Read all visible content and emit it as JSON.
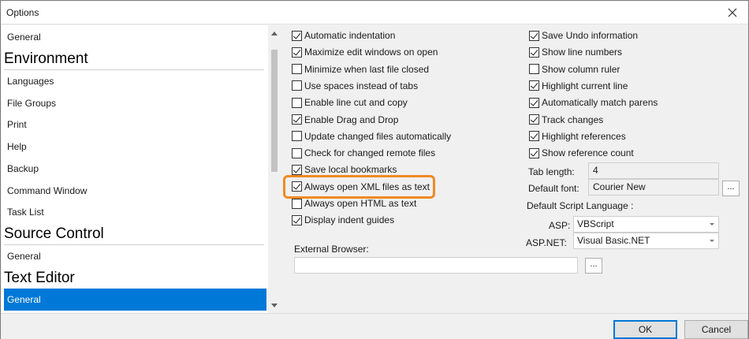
{
  "window": {
    "title": "Options"
  },
  "tree": {
    "items": [
      {
        "kind": "item",
        "label": "General"
      },
      {
        "kind": "category",
        "label": "Environment"
      },
      {
        "kind": "item",
        "label": "Languages"
      },
      {
        "kind": "item",
        "label": "File Groups"
      },
      {
        "kind": "item",
        "label": "Print"
      },
      {
        "kind": "item",
        "label": "Help"
      },
      {
        "kind": "item",
        "label": "Backup"
      },
      {
        "kind": "item",
        "label": "Command Window"
      },
      {
        "kind": "item",
        "label": "Task List"
      },
      {
        "kind": "category",
        "label": "Source Control"
      },
      {
        "kind": "item",
        "label": "General"
      },
      {
        "kind": "category",
        "label": "Text Editor"
      },
      {
        "kind": "item",
        "label": "General",
        "selected": true
      }
    ]
  },
  "options": {
    "left": [
      {
        "label": "Automatic indentation",
        "checked": true
      },
      {
        "label": "Maximize edit windows on open",
        "checked": true
      },
      {
        "label": "Minimize when last file closed",
        "checked": false
      },
      {
        "label": "Use spaces instead of tabs",
        "checked": false
      },
      {
        "label": "Enable line cut and copy",
        "checked": false
      },
      {
        "label": "Enable Drag and Drop",
        "checked": true
      },
      {
        "label": "Update changed files automatically",
        "checked": false
      },
      {
        "label": "Check for changed remote files",
        "checked": false
      },
      {
        "label": "Save local bookmarks",
        "checked": true
      },
      {
        "label": "Always open XML files as text",
        "checked": true
      },
      {
        "label": "Always open HTML as text",
        "checked": false
      },
      {
        "label": "Display indent guides",
        "checked": true
      }
    ],
    "right": [
      {
        "label": "Save Undo information",
        "checked": true
      },
      {
        "label": "Show line numbers",
        "checked": true
      },
      {
        "label": "Show column ruler",
        "checked": false
      },
      {
        "label": "Highlight current line",
        "checked": true
      },
      {
        "label": "Automatically match parens",
        "checked": true
      },
      {
        "label": "Track changes",
        "checked": true
      },
      {
        "label": "Highlight references",
        "checked": true
      },
      {
        "label": "Show reference count",
        "checked": true
      }
    ],
    "tab_length": {
      "label": "Tab length:",
      "value": "4"
    },
    "default_font": {
      "label": "Default font:",
      "value": "Courier New",
      "browse": "..."
    },
    "script_language": {
      "label": "Default Script Language :",
      "asp": {
        "label": "ASP:",
        "value": "VBScript"
      },
      "aspnet": {
        "label": "ASP.NET:",
        "value": "Visual Basic.NET"
      }
    },
    "external_browser": {
      "label": "External Browser:",
      "value": "",
      "browse": "..."
    }
  },
  "buttons": {
    "ok": "OK",
    "cancel": "Cancel"
  },
  "colors": {
    "selection": "#0078d7",
    "highlight_ring": "#f08a24"
  }
}
